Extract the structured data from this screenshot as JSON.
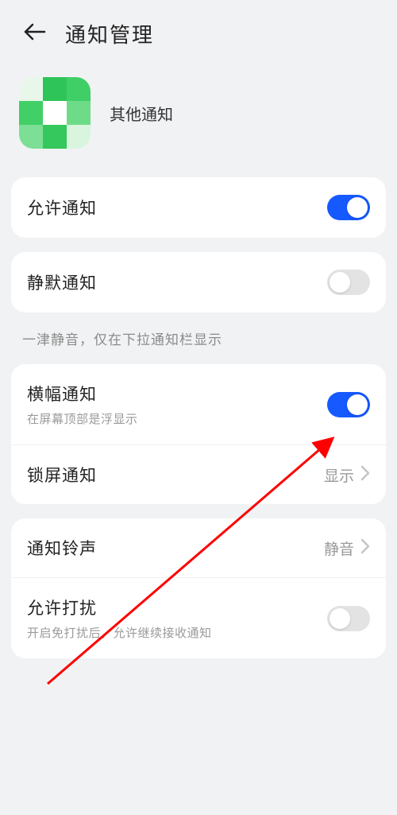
{
  "header": {
    "title": "通知管理"
  },
  "app": {
    "name": "其他通知"
  },
  "rows": {
    "allow": {
      "title": "允许通知",
      "on": true
    },
    "silent": {
      "title": "静默通知",
      "on": false
    },
    "silentHint": "一津静音，仅在下拉通知栏显示",
    "banner": {
      "title": "横幅通知",
      "sub": "在屏幕顶部是浮显示",
      "on": true
    },
    "lock": {
      "title": "锁屏通知",
      "value": "显示"
    },
    "ring": {
      "title": "通知铃声",
      "value": "静音"
    },
    "dnd": {
      "title": "允许打扰",
      "sub": "开启免打扰后，允许继续接收通知",
      "on": false
    }
  }
}
